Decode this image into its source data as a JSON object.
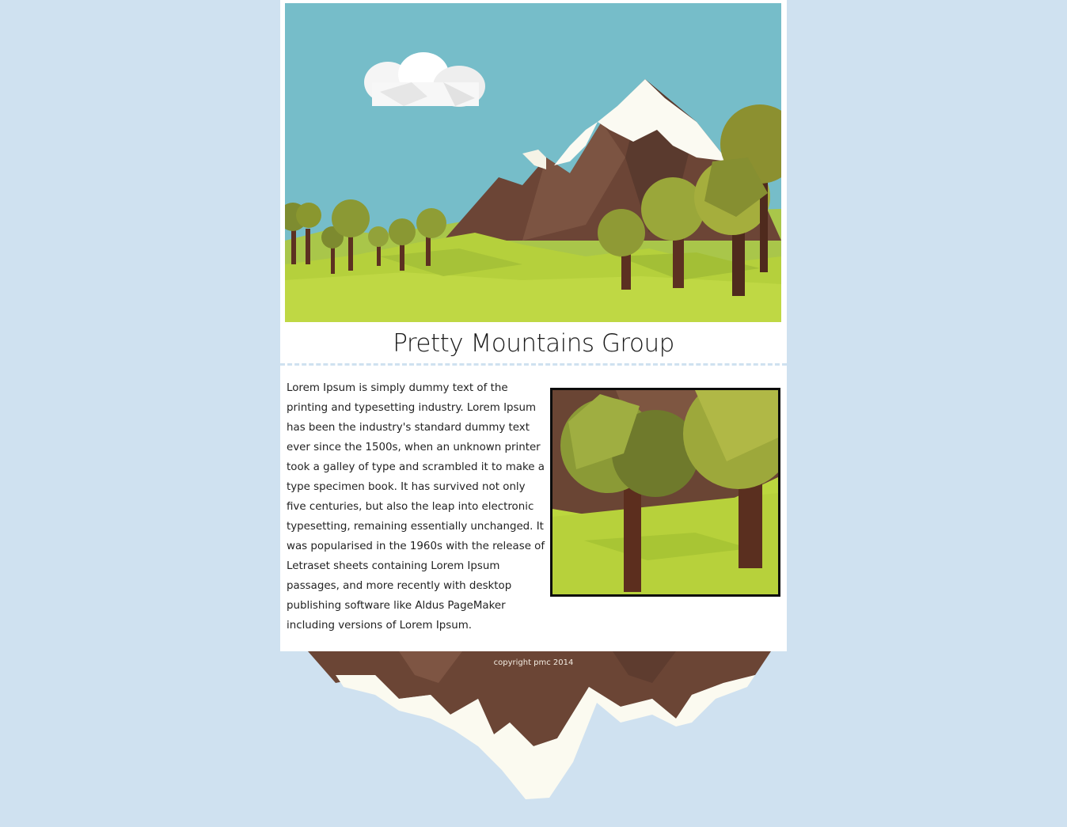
{
  "site": {
    "title": "Pretty Mountains Group"
  },
  "hero": {
    "icon": "low-poly-mountain-landscape"
  },
  "content": {
    "paragraph": "Lorem Ipsum is simply dummy text of the printing and typesetting industry. Lorem Ipsum has been the industry's standard dummy text ever since the 1500s, when an unknown printer took a galley of type and scrambled it to make a type specimen book. It has survived not only five centuries, but also the leap into electronic typesetting, remaining essentially unchanged. It was popularised in the 1960s with the release of Letraset sheets containing Lorem Ipsum passages, and more recently with desktop publishing software like Aldus PageMaker including versions of Lorem Ipsum.",
    "thumbnail_icon": "low-poly-trees"
  },
  "footer": {
    "copyright": "copyright pmc 2014"
  },
  "colors": {
    "background": "#cfe1f0",
    "card": "#ffffff",
    "sky": "#76bdc9",
    "grass": "#b8d13e",
    "mountain": "#6f4a3a",
    "snow": "#fbfaf2",
    "tree_foliage": "#8f9a35",
    "trunk": "#5c3021"
  }
}
